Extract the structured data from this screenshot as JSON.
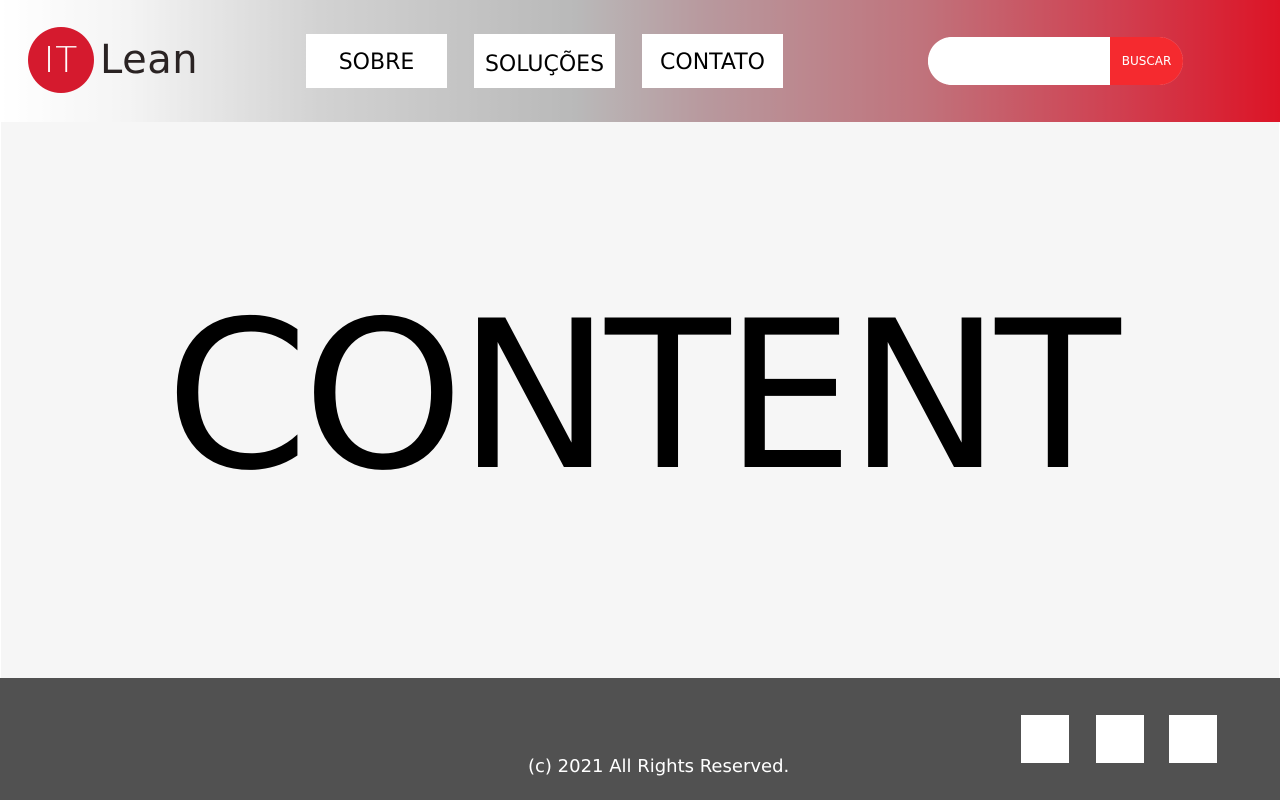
{
  "header": {
    "logo": {
      "mark_text": "IT",
      "word_text": "Lean",
      "mark_color": "#d51a2e"
    },
    "nav": [
      {
        "label": "SOBRE"
      },
      {
        "label": "SOLUÇÕES"
      },
      {
        "label": "CONTATO"
      }
    ],
    "search": {
      "value": "",
      "placeholder": "",
      "button_label": "BUSCAR",
      "button_color": "#f52a2f"
    },
    "gradient_colors": [
      "#ffffff",
      "#b9b9b9",
      "#dc1426"
    ]
  },
  "main": {
    "content_text": "CONTENT",
    "background": "#f6f6f6"
  },
  "footer": {
    "copyright": "(c) 2021 All Rights Reserved.",
    "background": "#515151",
    "social_icons": [
      {
        "name": "social-icon-1"
      },
      {
        "name": "social-icon-2"
      },
      {
        "name": "social-icon-3"
      }
    ]
  }
}
